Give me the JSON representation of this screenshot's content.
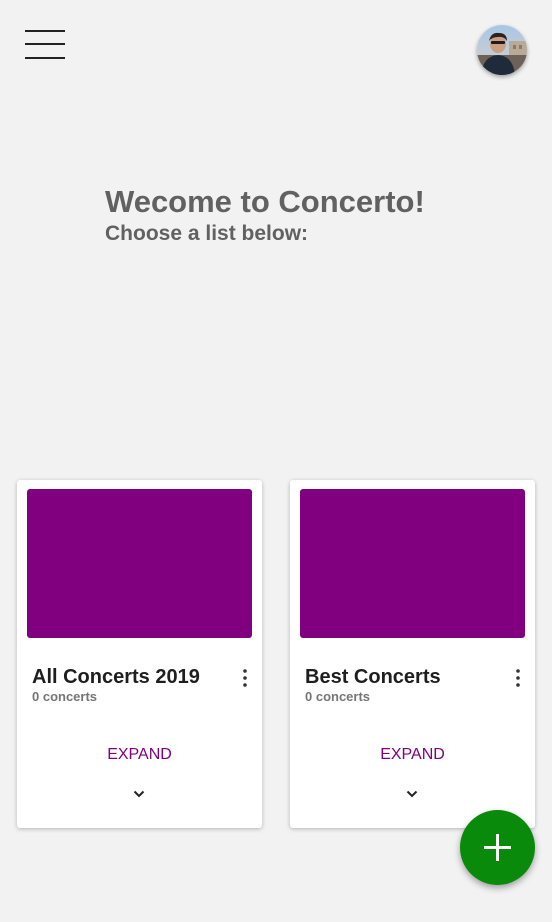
{
  "header": {
    "menu_icon": "hamburger-menu-icon",
    "avatar_icon": "user-avatar"
  },
  "welcome": {
    "title": "Wecome to Concerto!",
    "subtitle": "Choose a list below:"
  },
  "lists": [
    {
      "title": "All Concerts 2019",
      "count": "0 concerts",
      "expand_label": "EXPAND",
      "cover_color": "#800080"
    },
    {
      "title": "Best Concerts",
      "count": "0 concerts",
      "expand_label": "EXPAND",
      "cover_color": "#800080"
    }
  ],
  "fab": {
    "icon": "plus-icon",
    "color": "#0a8a0a"
  },
  "colors": {
    "background": "#f2f2f2",
    "heading": "#616161",
    "accent": "#800080"
  }
}
